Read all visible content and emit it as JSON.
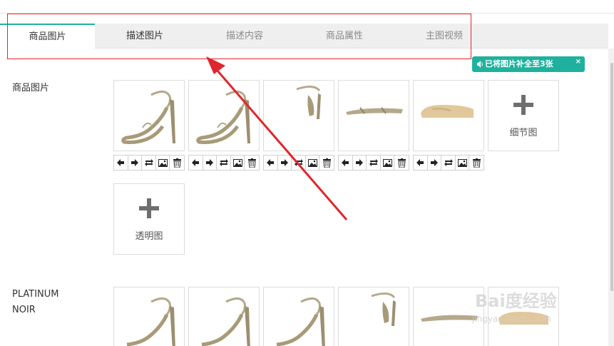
{
  "tabs": [
    {
      "label": "商品图片",
      "state": "active"
    },
    {
      "label": "描述图片",
      "state": "normal"
    },
    {
      "label": "描述内容",
      "state": "muted"
    },
    {
      "label": "商品属性",
      "state": "muted"
    },
    {
      "label": "主图视频",
      "state": "muted"
    }
  ],
  "notice": {
    "text": "已将图片补全至3张",
    "close": "×",
    "icon": "speaker-icon"
  },
  "sections": [
    {
      "label": "商品图片",
      "add_tiles": [
        "细节图",
        "透明图"
      ]
    },
    {
      "label_line1": "PLATINUM",
      "label_line2": "NOIR"
    }
  ],
  "toolbar_icons": [
    "arrow-left-icon",
    "arrow-right-icon",
    "rotate-icon",
    "image-icon",
    "trash-icon"
  ],
  "colors": {
    "accent": "#1fb19e",
    "annotation": "#e0262c"
  },
  "watermark": {
    "main": "Bai度经验",
    "sub": "jingyan.baidu.com"
  }
}
